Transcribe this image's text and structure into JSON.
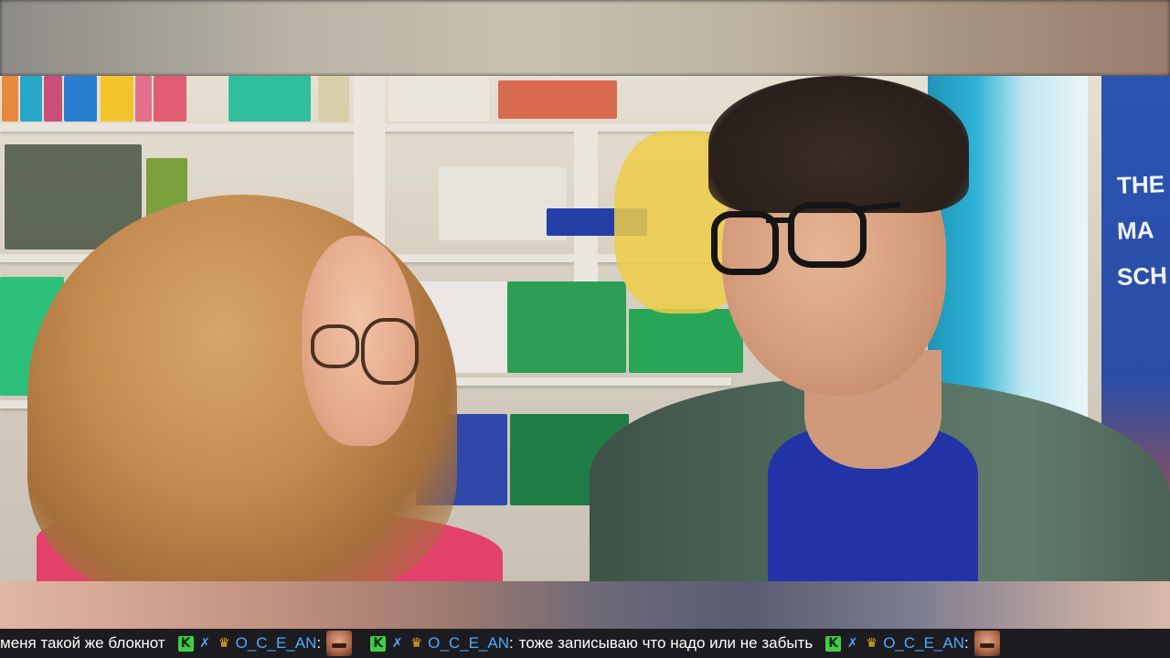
{
  "colors": {
    "username": "#4ea8ff",
    "message_text": "#ffffff",
    "ticker_background": "#1c1c20"
  },
  "video": {
    "poster_lines": [
      "THE",
      "MA",
      "SCH"
    ]
  },
  "chat_ticker": {
    "messages": [
      {
        "text": "меня такой же блокнот"
      },
      {
        "badges": [
          "k-badge",
          "sword-icon",
          "crown-icon"
        ],
        "username": "O_C_E_AN",
        "colon": ":",
        "emote": "face-emote",
        "text": ""
      },
      {
        "badges": [
          "k-badge",
          "sword-icon",
          "crown-icon"
        ],
        "username": "O_C_E_AN",
        "colon": ":",
        "text": "тоже записываю что надо или не забыть"
      },
      {
        "badges": [
          "k-badge",
          "sword-icon",
          "crown-icon"
        ],
        "username": "O_C_E_AN",
        "colon": ":",
        "emote": "face-emote"
      }
    ]
  }
}
